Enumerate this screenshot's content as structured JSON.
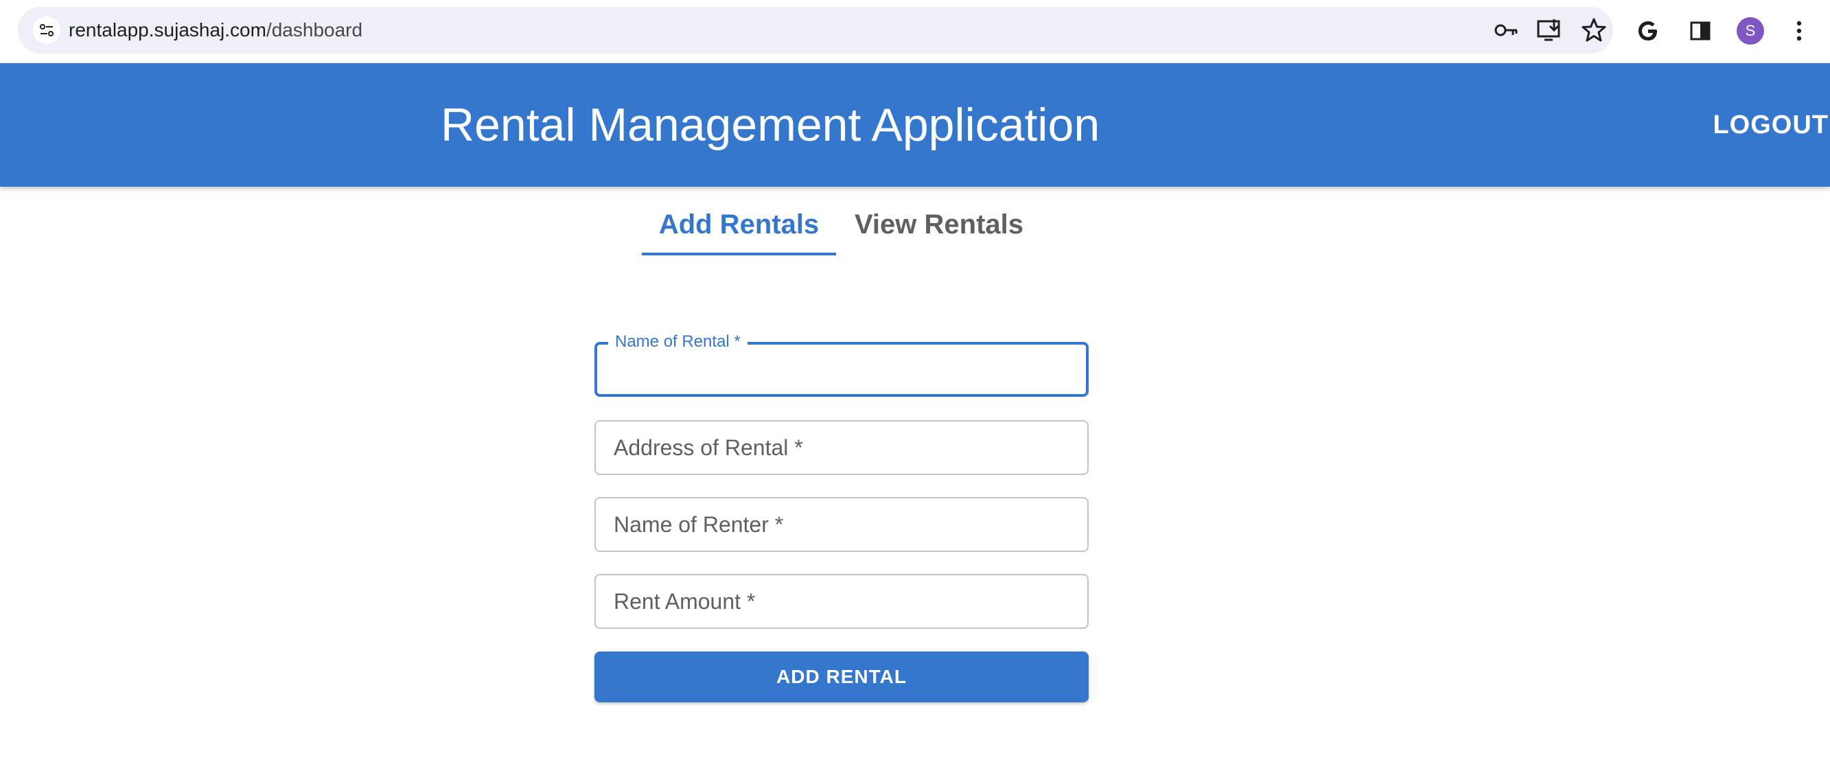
{
  "browser": {
    "url_host": "rentalapp.sujashaj.com",
    "url_path": "/dashboard",
    "site_icon": "tune-icon",
    "omnibox_actions": [
      "key-icon",
      "install-app-icon",
      "star-icon"
    ],
    "toolbar_actions": [
      "google-icon",
      "side-panel-icon",
      "profile-avatar",
      "more-menu-icon"
    ],
    "profile_initial": "S",
    "profile_color": "#7e57c2"
  },
  "header": {
    "title": "Rental Management Application",
    "logout_label": "LOGOUT",
    "background_color": "#3477cc"
  },
  "tabs": [
    {
      "label": "Add Rentals",
      "active": true
    },
    {
      "label": "View Rentals",
      "active": false
    }
  ],
  "form": {
    "fields": [
      {
        "label": "Name of Rental *",
        "value": "",
        "focused": true
      },
      {
        "label": "Address of Rental *",
        "value": "",
        "focused": false
      },
      {
        "label": "Name of Renter *",
        "value": "",
        "focused": false
      },
      {
        "label": "Rent Amount *",
        "value": "",
        "focused": false
      }
    ],
    "submit_label": "ADD RENTAL"
  },
  "colors": {
    "primary": "#3477cc",
    "inactive_tab": "#606060",
    "field_border": "#c4c4c4"
  }
}
